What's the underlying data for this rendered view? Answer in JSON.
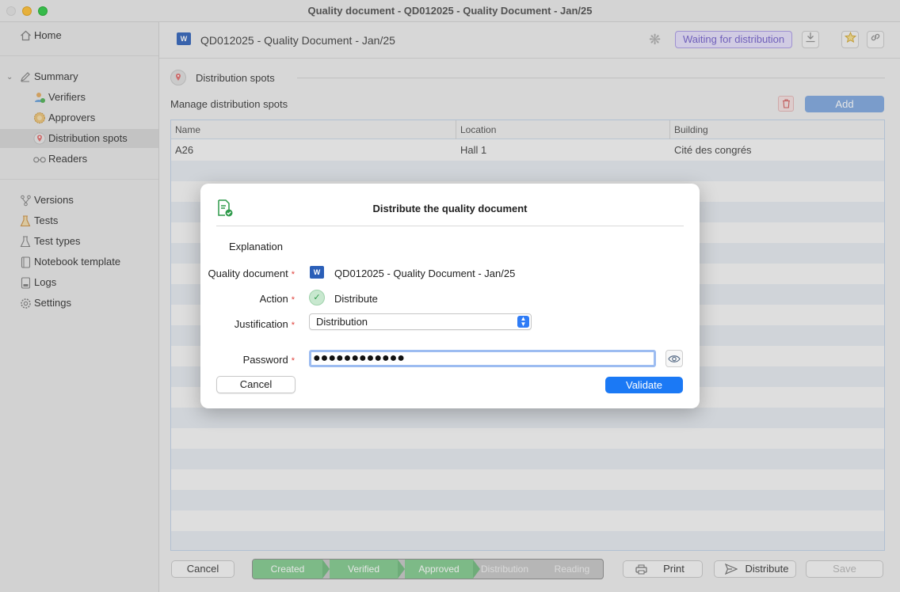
{
  "window": {
    "title": "Quality document - QD012025 - Quality Document - Jan/25"
  },
  "sidebar": {
    "home": "Home",
    "summary": "Summary",
    "sub_items": [
      "Verifiers",
      "Approvers",
      "Distribution spots",
      "Readers"
    ],
    "items": [
      "Versions",
      "Tests",
      "Test types",
      "Notebook template",
      "Logs",
      "Settings"
    ],
    "selected": "Distribution spots"
  },
  "header": {
    "doc_icon": "word-icon",
    "doc_title": "QD012025 - Quality Document - Jan/25",
    "status": "Waiting for distribution",
    "status_color": "#6e5bc9"
  },
  "section": {
    "title": "Distribution spots",
    "manage_label": "Manage distribution spots",
    "add_label": "Add"
  },
  "table": {
    "columns": [
      "Name",
      "Location",
      "Building"
    ],
    "rows": [
      [
        "A26",
        "Hall 1",
        "Cité des congrés"
      ]
    ]
  },
  "footer": {
    "cancel_label": "Cancel",
    "workflow": [
      {
        "label": "Created",
        "done": true
      },
      {
        "label": "Verified",
        "done": true
      },
      {
        "label": "Approved",
        "done": true
      },
      {
        "label": "Distribution",
        "done": false
      },
      {
        "label": "Reading",
        "done": false
      }
    ],
    "print_label": "Print",
    "distribute_label": "Distribute",
    "save_label": "Save"
  },
  "modal": {
    "title": "Distribute the quality document",
    "explanation": "Explanation",
    "fields": {
      "quality_document_label": "Quality document",
      "quality_document_value": "QD012025 - Quality Document - Jan/25",
      "action_label": "Action",
      "action_value": "Distribute",
      "justification_label": "Justification",
      "justification_value": "Distribution",
      "password_label": "Password",
      "password_value": "●●●●●●●●●●●●"
    },
    "required_marker": "*",
    "cancel_label": "Cancel",
    "validate_label": "Validate",
    "accent_color": "#1b79f5"
  }
}
